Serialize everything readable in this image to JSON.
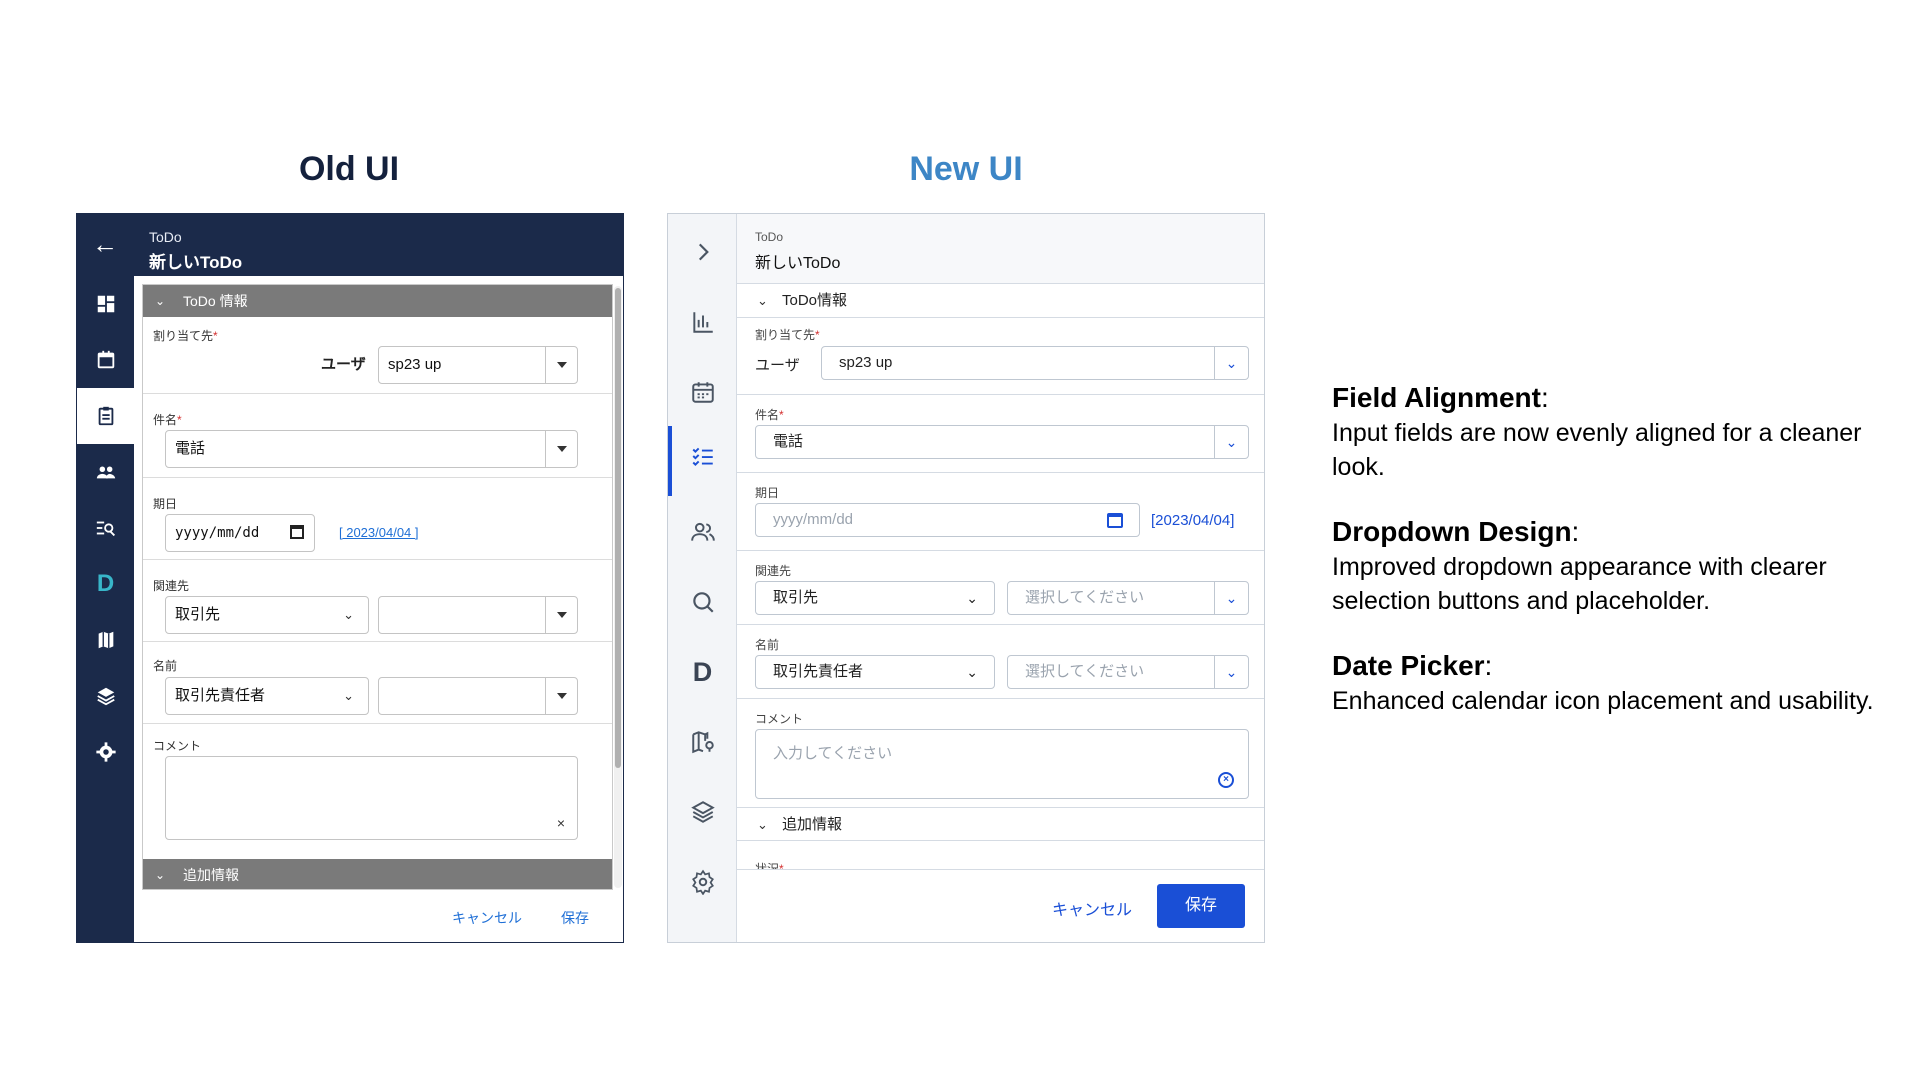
{
  "headings": {
    "old": "Old UI",
    "new": "New UI"
  },
  "old_ui": {
    "header": {
      "kicker": "ToDo",
      "title": "新しいToDo"
    },
    "section_todo": "ToDo 情報",
    "assignee": {
      "label": "割り当て先",
      "required": "*",
      "type_label": "ユーザ",
      "value": "sp23 up"
    },
    "subject": {
      "label": "件名",
      "required": "*",
      "value": "電話"
    },
    "due_date": {
      "label": "期日",
      "placeholder": "yyyy/mm/dd",
      "link": "[ 2023/04/04 ]"
    },
    "related": {
      "label": "関連先",
      "value": "取引先",
      "second_value": ""
    },
    "name": {
      "label": "名前",
      "value": "取引先責任者",
      "second_value": ""
    },
    "comment": {
      "label": "コメント",
      "clear": "×"
    },
    "section_extra": "追加情報",
    "footer": {
      "cancel": "キャンセル",
      "save": "保存"
    }
  },
  "new_ui": {
    "header": {
      "kicker": "ToDo",
      "title": "新しいToDo"
    },
    "section_todo": "ToDo情報",
    "assignee": {
      "label": "割り当て先",
      "required": "*",
      "type_label": "ユーザ",
      "value": "sp23 up"
    },
    "subject": {
      "label": "件名",
      "required": "*",
      "value": "電話"
    },
    "due_date": {
      "label": "期日",
      "placeholder": "yyyy/mm/dd",
      "link": "[2023/04/04]"
    },
    "related": {
      "label": "関連先",
      "value": "取引先",
      "second_placeholder": "選択してください"
    },
    "name": {
      "label": "名前",
      "value": "取引先責任者",
      "second_placeholder": "選択してください"
    },
    "comment": {
      "label": "コメント",
      "placeholder": "入力してください"
    },
    "section_extra": "追加情報",
    "cut_label": "状況",
    "cut_required": "*",
    "footer": {
      "cancel": "キャンセル",
      "save": "保存"
    }
  },
  "notes": [
    {
      "title": "Field Alignment",
      "colon": ":",
      "body": "Input fields are now evenly aligned for a cleaner look."
    },
    {
      "title": "Dropdown Design",
      "colon": ":",
      "body": "Improved dropdown appearance with clearer selection buttons and placeholder."
    },
    {
      "title": "Date Picker",
      "colon": ":",
      "body": "Enhanced calendar icon placement and usability."
    }
  ],
  "colors": {
    "old_navy": "#1b2a4a",
    "new_blue": "#1a4fd6",
    "new_heading": "#3d86c6",
    "old_heading": "#14213d"
  }
}
